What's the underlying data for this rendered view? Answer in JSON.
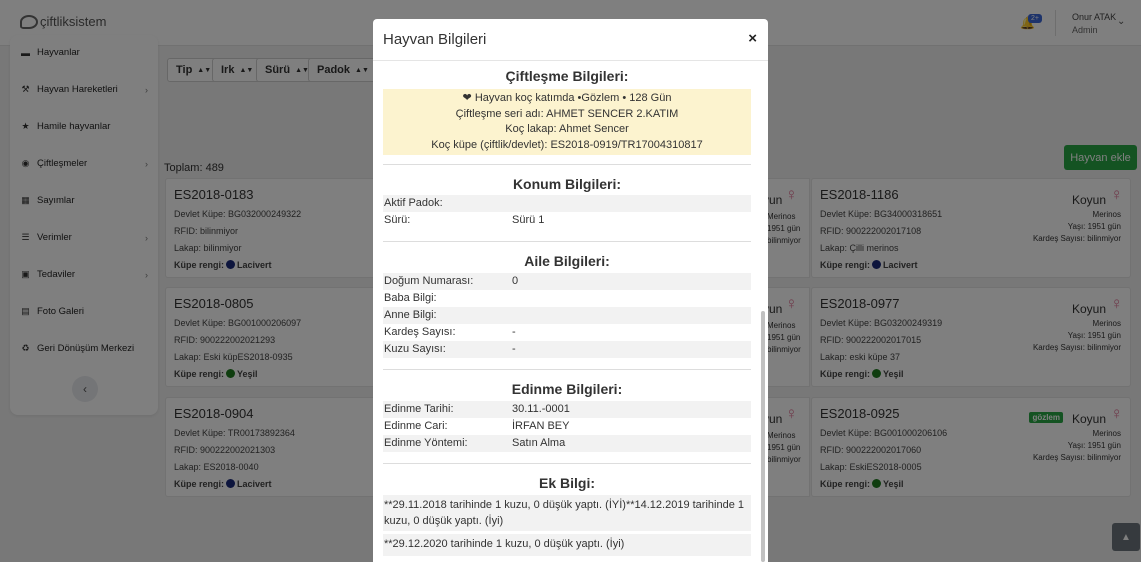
{
  "app": {
    "logo_text": "çiftliksistem",
    "notification_badge": "2+",
    "user_name": "Onur ATAK",
    "user_role": "Admin"
  },
  "sidebar": {
    "items": [
      {
        "label": "Hayvanlar",
        "icon": "truck-icon",
        "has_chevron": false
      },
      {
        "label": "Hayvan Hareketleri",
        "icon": "wrench-icon",
        "has_chevron": true
      },
      {
        "label": "Hamile hayvanlar",
        "icon": "star-icon",
        "has_chevron": false
      },
      {
        "label": "Çiftleşmeler",
        "icon": "circle-dot-icon",
        "has_chevron": true
      },
      {
        "label": "Sayımlar",
        "icon": "calculator-icon",
        "has_chevron": false
      },
      {
        "label": "Verimler",
        "icon": "list-icon",
        "has_chevron": true
      },
      {
        "label": "Tedaviler",
        "icon": "medkit-icon",
        "has_chevron": true
      },
      {
        "label": "Foto Galeri",
        "icon": "image-icon",
        "has_chevron": false
      },
      {
        "label": "Geri Dönüşüm Merkezi",
        "icon": "recycle-icon",
        "has_chevron": false
      }
    ],
    "collapse_symbol": "‹"
  },
  "filters": [
    "Tip",
    "Irk",
    "Sürü",
    "Padok"
  ],
  "total_label": "Toplam: 489",
  "add_button": "Hayvan ekle",
  "card_common": {
    "kind": "Koyun",
    "breed": "Merinos",
    "age": "Yaşı: 1951 gün",
    "siblings": "Kardeş Sayısı: bilinmiyor",
    "color_label": "Küpe rengi:"
  },
  "partial_common": {
    "kind": "yun",
    "breed": "Merinos",
    "age": "1951 gün",
    "sib": "bilinmiyor"
  },
  "cards_left": [
    {
      "title": "ES2018-0183",
      "devlet": "Devlet Küpe: BG032000249322",
      "rfid": "RFID: bilinmiyor",
      "lakap": "Lakap: bilinmiyor",
      "color": "Lacivert",
      "color_hex": "#1a2a7a"
    },
    {
      "title": "ES2018-0805",
      "devlet": "Devlet Küpe: BG001000206097",
      "rfid": "RFID: 900222002021293",
      "lakap": "Lakap: Eski küpES2018-0935",
      "color": "Yeşil",
      "color_hex": "#1e7a1e"
    },
    {
      "title": "ES2018-0904",
      "devlet": "Devlet Küpe: TR00173892364",
      "rfid": "RFID: 900222002021303",
      "lakap": "Lakap: ES2018-0040",
      "color": "Lacivert",
      "color_hex": "#1a2a7a"
    }
  ],
  "cards_right": [
    {
      "title": "ES2018-1186",
      "devlet": "Devlet Küpe: BG34000318651",
      "rfid": "RFID: 900222002017108",
      "lakap": "Lakap: Çilli merinos",
      "color": "Lacivert",
      "color_hex": "#1a2a7a",
      "badge": ""
    },
    {
      "title": "ES2018-0977",
      "devlet": "Devlet Küpe: BG03200249319",
      "rfid": "RFID: 900222002017015",
      "lakap": "Lakap: eski küpe 37",
      "color": "Yeşil",
      "color_hex": "#1e7a1e",
      "badge": ""
    },
    {
      "title": "ES2018-0925",
      "devlet": "Devlet Küpe: BG001000206106",
      "rfid": "RFID: 900222002017060",
      "lakap": "Lakap: EskiES2018-0005",
      "color": "Yeşil",
      "color_hex": "#1e7a1e",
      "badge": "gözlem"
    }
  ],
  "modal": {
    "title": "Hayvan Bilgileri",
    "close": "×",
    "mating": {
      "title": "Çiftleşme Bilgileri:",
      "lines": [
        "❤ Hayvan koç katımda •Gözlem • 128 Gün",
        "Çiftleşme seri adı: AHMET SENCER 2.KATIM",
        "Koç lakap: Ahmet Sencer",
        "Koç küpe (çiftlik/devlet): ES2018-0919/TR17004310817"
      ]
    },
    "location": {
      "title": "Konum Bilgileri:",
      "rows": [
        {
          "k": "Aktif Padok:",
          "v": ""
        },
        {
          "k": "Sürü:",
          "v": "Sürü 1"
        }
      ]
    },
    "family": {
      "title": "Aile Bilgileri:",
      "rows": [
        {
          "k": "Doğum Numarası:",
          "v": "0"
        },
        {
          "k": "Baba Bilgi:",
          "v": ""
        },
        {
          "k": "Anne Bilgi:",
          "v": ""
        },
        {
          "k": "Kardeş Sayısı:",
          "v": "-"
        },
        {
          "k": "Kuzu Sayısı:",
          "v": "-"
        }
      ]
    },
    "acquisition": {
      "title": "Edinme Bilgileri:",
      "rows": [
        {
          "k": "Edinme Tarihi:",
          "v": "30.11.-0001"
        },
        {
          "k": "Edinme Cari:",
          "v": "İRFAN BEY"
        },
        {
          "k": "Edinme Yöntemi:",
          "v": "Satın Alma"
        }
      ]
    },
    "extra": {
      "title": "Ek Bilgi:",
      "notes": [
        "**29.11.2018 tarihinde 1 kuzu, 0 düşük yaptı. (İYİ)**14.12.2019 tarihinde 1 kuzu, 0 düşük yaptı. (İyi)",
        "**29.12.2020 tarihinde 1 kuzu, 0 düşük yaptı. (İyi)"
      ]
    }
  }
}
